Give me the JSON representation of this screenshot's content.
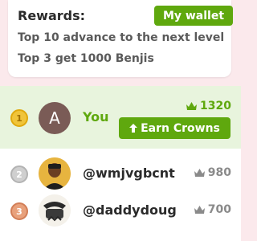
{
  "rewards": {
    "title": "Rewards:",
    "wallet_button": "My wallet",
    "line1": "Top 10 advance to the next level",
    "line2": "Top 3 get 1000 Benjis"
  },
  "leaderboard": {
    "you": {
      "rank": "1",
      "initial": "A",
      "name": "You",
      "crowns": "1320",
      "earn_button": "Earn Crowns"
    },
    "rows": [
      {
        "rank": "2",
        "name": "@wmjvgbcnt",
        "crowns": "980"
      },
      {
        "rank": "3",
        "name": "@daddydoug",
        "crowns": "700"
      }
    ]
  },
  "colors": {
    "accent": "#5fa80e",
    "highlight_row": "#e8f4dd",
    "background": "#fbe9ec",
    "gold": "#f0c43a",
    "silver": "#cfcfcf",
    "bronze": "#e8a17c"
  },
  "icons": [
    "crown-icon",
    "arrow-up-icon"
  ]
}
